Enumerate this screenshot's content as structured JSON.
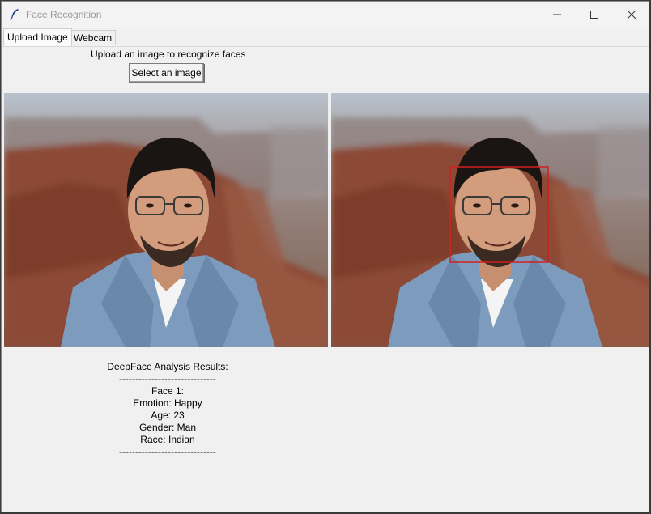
{
  "window": {
    "title": "Face Recognition",
    "icon": "feather-icon",
    "controls": [
      "minimize-icon",
      "maximize-icon",
      "close-icon"
    ]
  },
  "tabs": [
    {
      "label": "Upload Image",
      "active": true
    },
    {
      "label": "Webcam",
      "active": false
    }
  ],
  "upload": {
    "instruction": "Upload an image to recognize faces",
    "button_label": "Select an image"
  },
  "images": {
    "original": "uploaded photo: young man with glasses in denim jacket, canyon background",
    "processed": "same photo with red face detection box"
  },
  "colors": {
    "detection_box": "#d02020",
    "background": "#f0f0f0"
  },
  "results": {
    "heading": "DeepFace Analysis Results:",
    "separator": "------------------------------",
    "faces": [
      {
        "label": "Face 1:",
        "emotion": "Emotion: Happy",
        "age": "Age: 23",
        "gender": "Gender: Man",
        "race": "Race: Indian"
      }
    ],
    "separator_end": "------------------------------"
  }
}
